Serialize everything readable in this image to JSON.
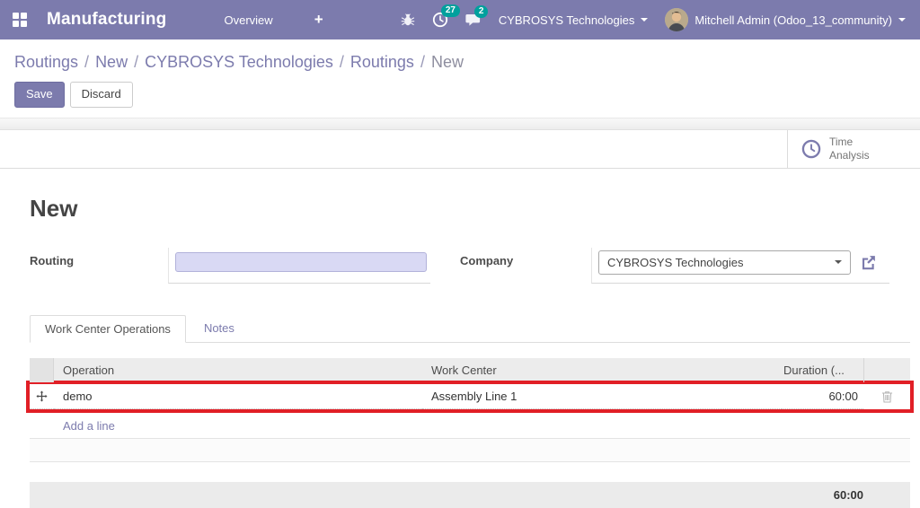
{
  "navbar": {
    "app_name": "Manufacturing",
    "menu_overview": "Overview",
    "plus": "+",
    "activity_count": "27",
    "message_count": "2",
    "company": "CYBROSYS Technologies",
    "user": "Mitchell Admin (Odoo_13_community)"
  },
  "breadcrumb": {
    "separator": "/",
    "items": [
      "Routings",
      "New",
      "CYBROSYS Technologies",
      "Routings",
      "New"
    ]
  },
  "actions": {
    "save": "Save",
    "discard": "Discard"
  },
  "stat_button": {
    "line1": "Time",
    "line2": "Analysis"
  },
  "form": {
    "title": "New",
    "routing_label": "Routing",
    "routing_value": "",
    "company_label": "Company",
    "company_value": "CYBROSYS Technologies"
  },
  "tabs": [
    {
      "label": "Work Center Operations",
      "active": true
    },
    {
      "label": "Notes",
      "active": false
    }
  ],
  "operations_table": {
    "columns": [
      "Operation",
      "Work Center",
      "Duration (..."
    ],
    "rows": [
      {
        "operation": "demo",
        "work_center": "Assembly Line 1",
        "duration": "60:00"
      }
    ],
    "add_line_label": "Add a line",
    "total_duration": "60:00"
  },
  "colors": {
    "navbar_purple": "#7c7bad",
    "badge_teal": "#00a09d",
    "annotation_red": "#e11f26",
    "required_field_bg": "#d9d9f4",
    "link_purple": "#7c7bad"
  }
}
